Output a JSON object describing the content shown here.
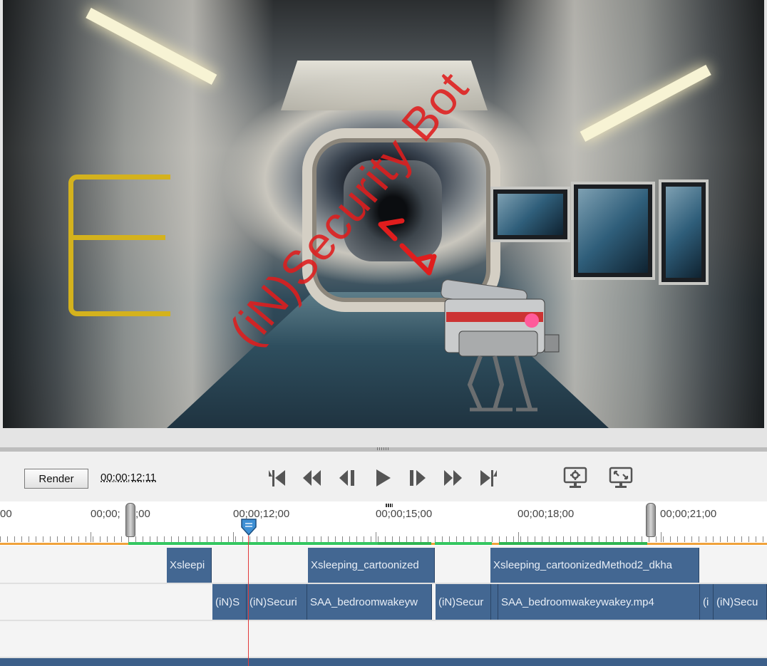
{
  "preview": {
    "overlay_text": "(iN)Security Bot"
  },
  "transport": {
    "render_label": "Render",
    "timecode": "00;00;12;11",
    "buttons": [
      {
        "icon": "go-to-start-icon"
      },
      {
        "icon": "rewind-icon"
      },
      {
        "icon": "previous-frame-icon"
      },
      {
        "icon": "play-icon"
      },
      {
        "icon": "next-frame-icon"
      },
      {
        "icon": "fast-forward-icon"
      },
      {
        "icon": "go-to-end-icon"
      },
      {
        "icon": "preview-settings-icon"
      },
      {
        "icon": "fullscreen-preview-icon"
      }
    ]
  },
  "ruler": {
    "labels": [
      "00",
      "00;00;09;00",
      "00;00;12;00",
      "00;00;15;00",
      "00;00;18;00",
      "00;00;21;00"
    ],
    "visible_labels": [
      "00",
      "00;00;",
      ";00",
      "00;00;12;00",
      "00;00;15;00",
      "00;00;18;00",
      "00;00;21;00"
    ]
  },
  "tracks": {
    "track1": [
      "Xsleepi",
      "Xsleeping_cartoonized",
      "Xsleeping_cartoonizedMethod2_dkha"
    ],
    "track2": [
      "(iN)S",
      "(iN)Securi",
      "SAA_bedroomwakeyw",
      "(iN)Secur",
      "SAA_bedroomwakeywakey.mp4",
      "(i",
      "(iN)Secu"
    ]
  },
  "colors": {
    "clip": "#436792",
    "playhead": "#e23a3a",
    "overlay": "#e01d1d",
    "work_area": "#34c760",
    "ruler_line": "#f0a23b"
  }
}
